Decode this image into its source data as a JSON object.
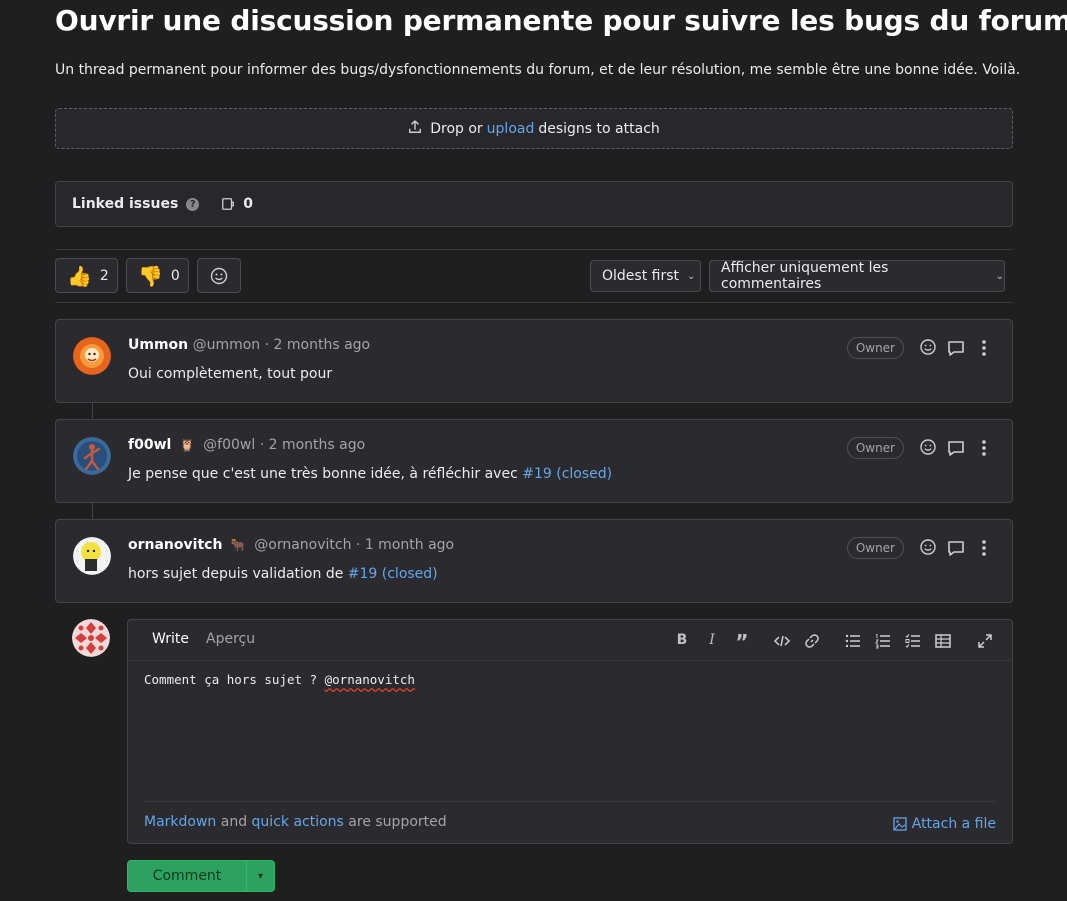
{
  "issue": {
    "title": "Ouvrir une discussion permanente pour suivre les bugs du forum",
    "description": "Un thread permanent pour informer des bugs/dysfonctionnements du forum, et de leur résolution, me semble être une bonne idée. Voilà."
  },
  "designs": {
    "pre": "Drop or",
    "link": "upload",
    "post": "designs to attach"
  },
  "linked_issues": {
    "label": "Linked issues",
    "help": "?",
    "count": "0"
  },
  "reactions": {
    "thumbs_up": "2",
    "thumbs_down": "0"
  },
  "sort": {
    "label": "Oldest first"
  },
  "filter": {
    "label": "Afficher uniquement les commentaires"
  },
  "notes": [
    {
      "name": "Ummon",
      "username": "@ummon",
      "time": "2 months ago",
      "badge": "Owner",
      "text": "Oui complètement, tout pour",
      "ref": ""
    },
    {
      "name": "f00wl",
      "status_emoji": "🦉",
      "username": "@f00wl",
      "time": "2 months ago",
      "badge": "Owner",
      "text": "Je pense que c'est une très bonne idée, à réfléchir avec",
      "ref": "#19 (closed)"
    },
    {
      "name": "ornanovitch",
      "status_emoji": "🐂",
      "username": "@ornanovitch",
      "time": "1 month ago",
      "badge": "Owner",
      "text": "hors sujet depuis validation de",
      "ref": "#19 (closed)"
    }
  ],
  "composer": {
    "tab_write": "Write",
    "tab_preview": "Aperçu",
    "text_prefix": "Comment ça hors sujet ? ",
    "text_mention": "@ornanovitch",
    "footer_link1": "Markdown",
    "footer_and": "and",
    "footer_link2": "quick actions",
    "footer_suffix": "are supported",
    "attach": "Attach a file",
    "submit": "Comment"
  },
  "colors": {
    "accent_link": "#63a6e9",
    "submit_green": "#2da160",
    "background": "#1f1f1f"
  }
}
